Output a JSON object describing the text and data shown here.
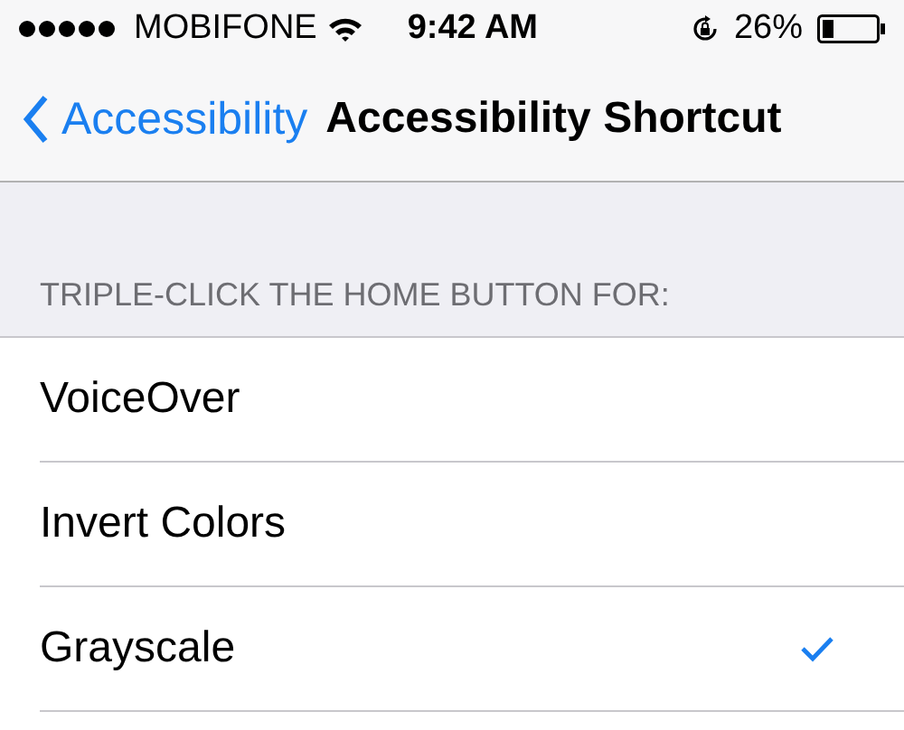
{
  "status_bar": {
    "carrier": "MOBIFONE",
    "time": "9:42 AM",
    "battery_percent": "26%"
  },
  "nav": {
    "back": "Accessibility",
    "title": "Accessibility Shortcut"
  },
  "section": {
    "header": "TRIPLE-CLICK THE HOME BUTTON FOR:"
  },
  "options": [
    {
      "label": "VoiceOver",
      "selected": false
    },
    {
      "label": "Invert Colors",
      "selected": false
    },
    {
      "label": "Grayscale",
      "selected": true
    }
  ]
}
